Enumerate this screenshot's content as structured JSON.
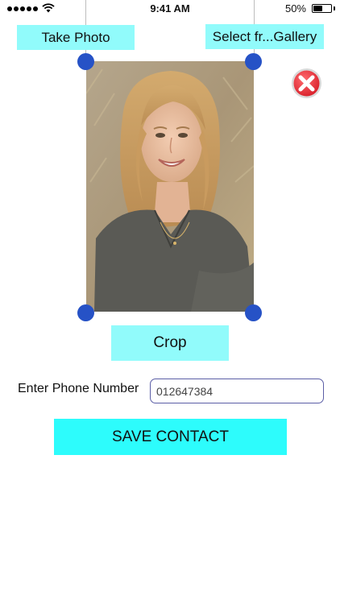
{
  "status_bar": {
    "time": "9:41 AM",
    "battery_percent_label": "50%",
    "battery_level": 0.5,
    "signal_icon": "signal-dots-icon",
    "wifi_icon": "wifi-icon"
  },
  "buttons": {
    "take_photo": "Take Photo",
    "select_gallery": "Select fr...Gallery",
    "crop": "Crop",
    "save_contact": "SAVE CONTACT"
  },
  "phone": {
    "label": "Enter Phone Number",
    "value": "012647384"
  },
  "icons": {
    "close": "close-icon",
    "crop_handle": "crop-handle-icon"
  },
  "colors": {
    "button_light_cyan": "#91fbfb",
    "button_cyan": "#2dfcfc",
    "handle_blue": "#2652c6",
    "close_red": "#e8323c",
    "input_border": "#5b5ea6"
  }
}
